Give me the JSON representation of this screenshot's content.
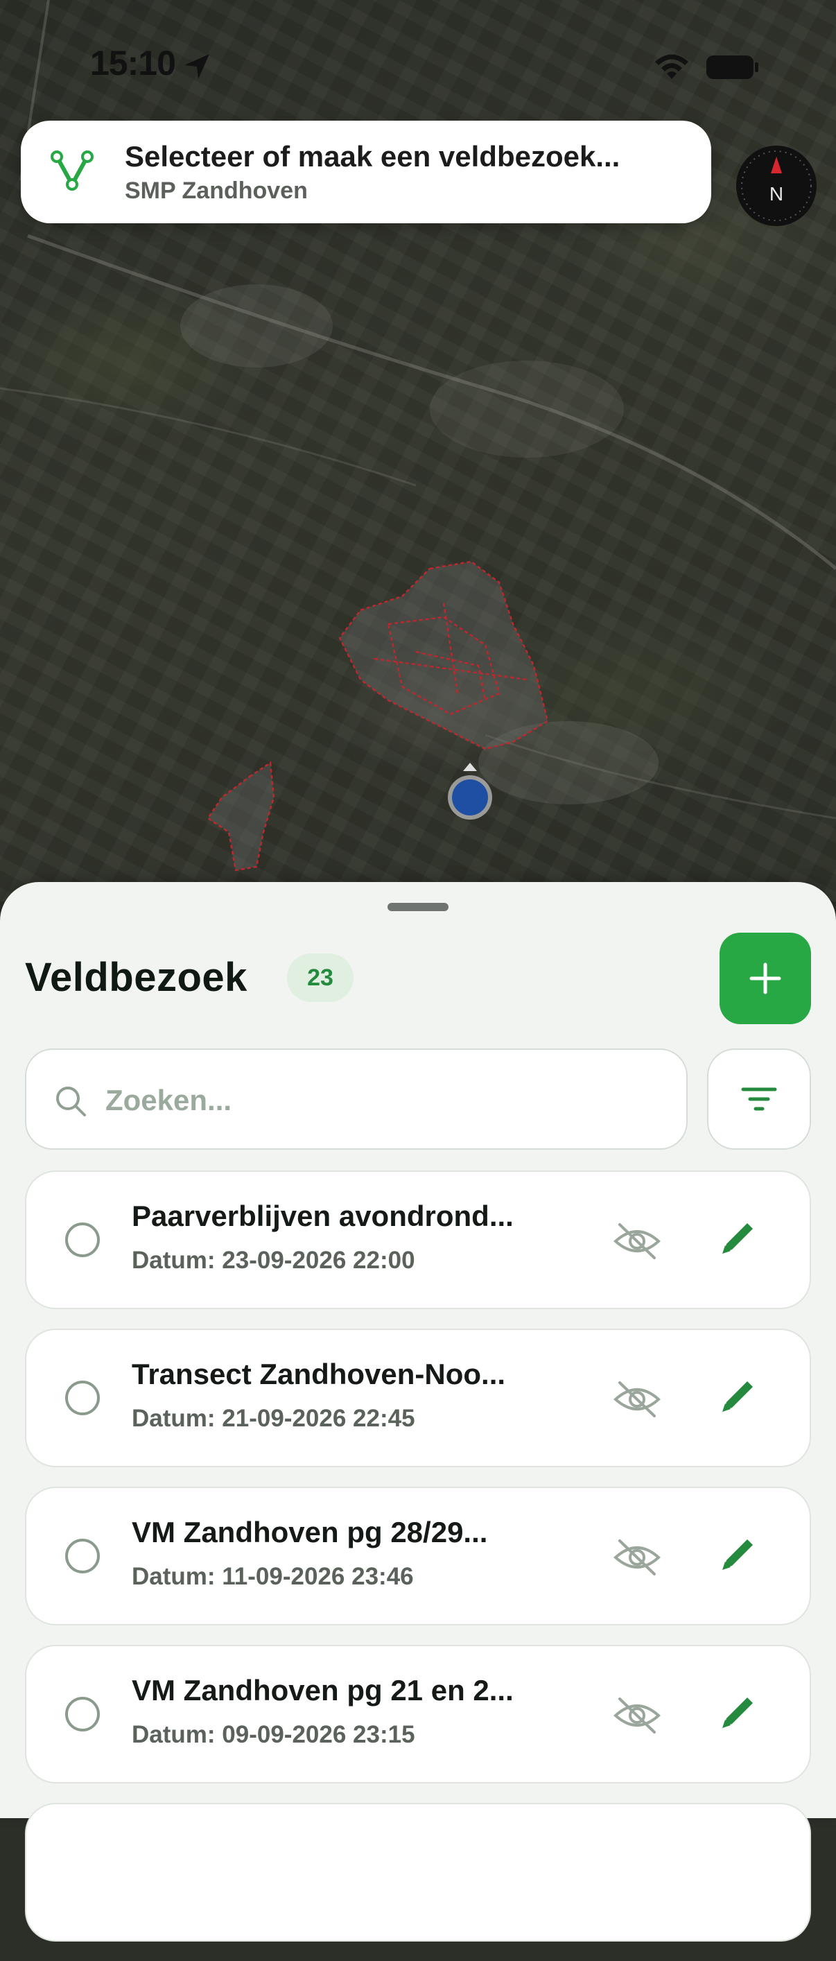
{
  "status_bar": {
    "time": "15:10"
  },
  "banner": {
    "title": "Selecteer of maak een veldbezoek...",
    "subtitle": "SMP Zandhoven"
  },
  "compass": {
    "label": "N"
  },
  "sheet": {
    "title": "Veldbezoek",
    "count": "23",
    "search_placeholder": "Zoeken...",
    "search_value": ""
  },
  "visits": [
    {
      "name": "Paarverblijven avondrond...",
      "date": "Datum: 23-09-2026 22:00"
    },
    {
      "name": "Transect Zandhoven-Noo...",
      "date": "Datum: 21-09-2026 22:45"
    },
    {
      "name": "VM Zandhoven pg 28/29...",
      "date": "Datum: 11-09-2026 23:46"
    },
    {
      "name": "VM Zandhoven pg 21 en 2...",
      "date": "Datum: 09-09-2026 23:15"
    }
  ],
  "colors": {
    "accent": "#28a745",
    "badge_bg": "#e0efe0",
    "area_outline": "#c0262d",
    "location_dot": "#1f4fa3"
  },
  "icons": {
    "banner": "route-v-icon",
    "add": "plus-icon",
    "search": "search-icon",
    "filter": "filter-icon",
    "hide": "eye-off-icon",
    "edit": "pencil-icon"
  }
}
